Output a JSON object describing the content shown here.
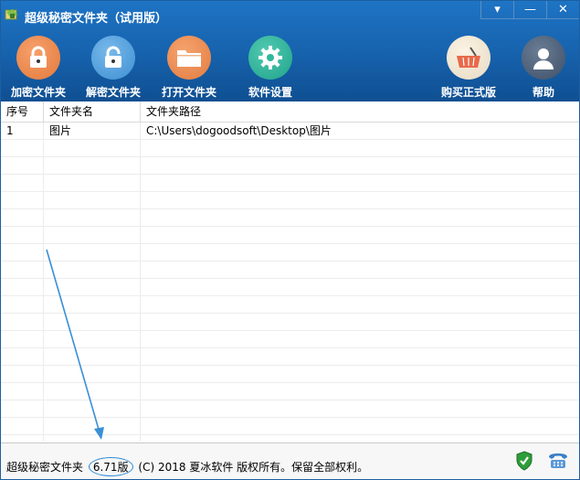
{
  "window": {
    "title": "超级秘密文件夹（试用版）"
  },
  "window_controls": {
    "menu": "▾",
    "minimize": "—",
    "close": "✕"
  },
  "toolbar": {
    "encrypt": {
      "label": "加密文件夹",
      "icon": "lock-icon",
      "color": "#E8824A"
    },
    "decrypt": {
      "label": "解密文件夹",
      "icon": "unlock-icon",
      "color": "#5AA6E0"
    },
    "open": {
      "label": "打开文件夹",
      "icon": "folder-icon",
      "color": "#E8824A"
    },
    "settings": {
      "label": "软件设置",
      "icon": "gear-icon",
      "color": "#2FB89C"
    },
    "buy": {
      "label": "购买正式版",
      "icon": "basket-icon",
      "color": "#F1E8D6"
    },
    "help": {
      "label": "帮助",
      "icon": "user-icon",
      "color": "#506480"
    }
  },
  "table": {
    "columns": [
      "序号",
      "文件夹名",
      "文件夹路径"
    ],
    "rows": [
      {
        "index": "1",
        "name": "图片",
        "path": "C:\\Users\\dogoodsoft\\Desktop\\图片"
      }
    ]
  },
  "status": {
    "prefix": "超级秘密文件夹",
    "version": "6.71版",
    "suffix": "(C) 2018 夏冰软件 版权所有。保留全部权利。"
  },
  "colors": {
    "header": "#1763AE",
    "accent": "#2F8AD8"
  }
}
